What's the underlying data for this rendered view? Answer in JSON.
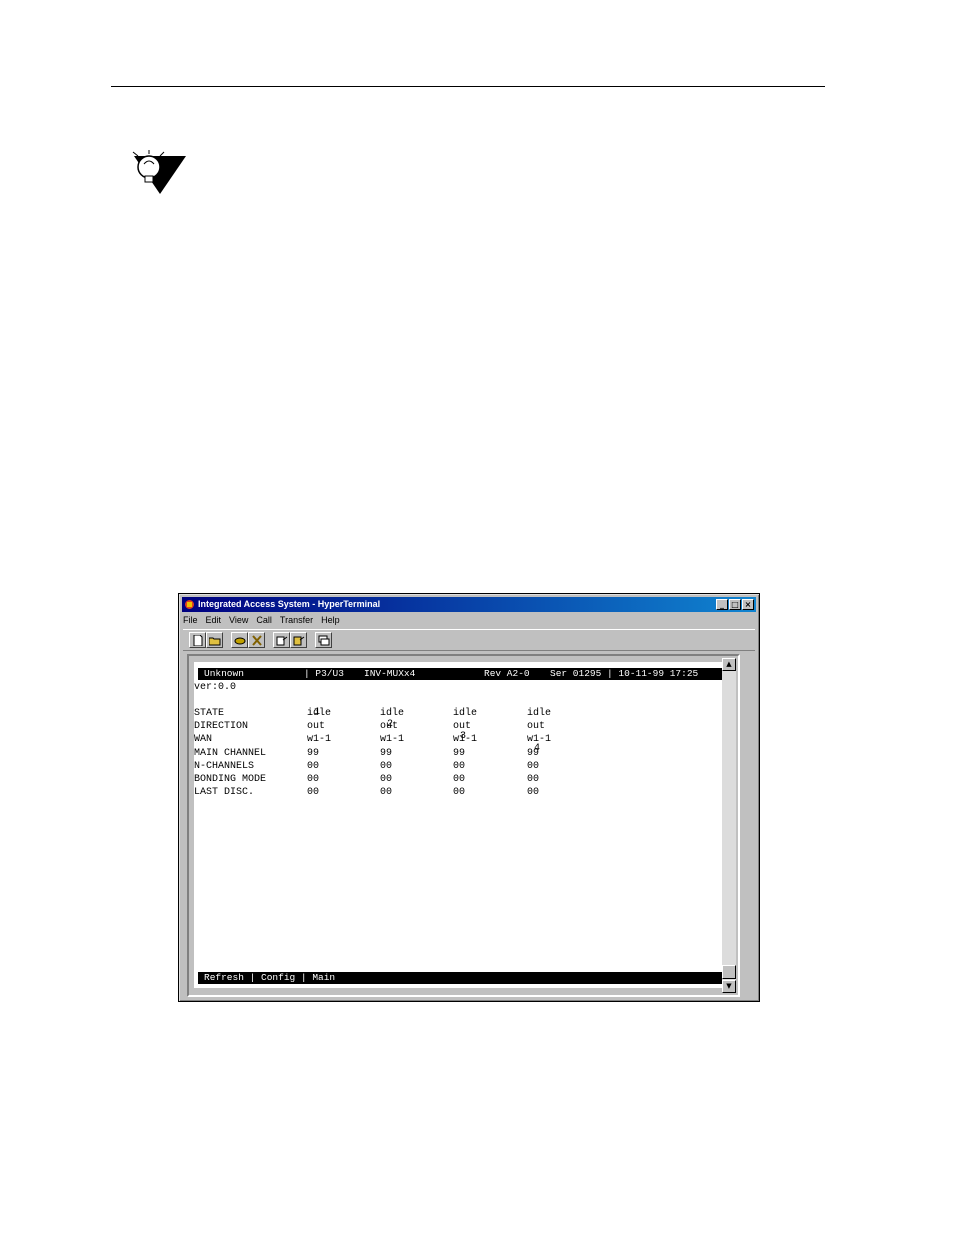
{
  "window": {
    "title": "Integrated Access System - HyperTerminal",
    "buttons": {
      "minimize": "_",
      "maximize": "□",
      "close": "×"
    }
  },
  "menu": [
    "File",
    "Edit",
    "View",
    "Call",
    "Transfer",
    "Help"
  ],
  "terminal": {
    "header": {
      "name": "Unknown",
      "slot": "| P3/U3",
      "card": "INV-MUXx4",
      "rev": "Rev A2-0",
      "ser": "Ser 01295 | 10-11-99 17:25"
    },
    "version": "ver:0.0",
    "columns": [
      "1",
      "2",
      "3",
      "4"
    ],
    "rows": [
      {
        "label": "STATE",
        "values": [
          "idle",
          "idle",
          "idle",
          "idle"
        ]
      },
      {
        "label": "DIRECTION",
        "values": [
          "out",
          "out",
          "out",
          "out"
        ]
      },
      {
        "label": "WAN",
        "values": [
          "w1-1",
          "w1-1",
          "w1-1",
          "w1-1"
        ]
      },
      {
        "label": "MAIN CHANNEL",
        "values": [
          "99",
          "99",
          "99",
          "99"
        ]
      },
      {
        "label": "N-CHANNELS",
        "values": [
          "00",
          "00",
          "00",
          "00"
        ]
      },
      {
        "label": "BONDING MODE",
        "values": [
          "00",
          "00",
          "00",
          "00"
        ]
      },
      {
        "label": "LAST DISC.",
        "values": [
          "00",
          "00",
          "00",
          "00"
        ]
      }
    ],
    "footer": "Refresh | Config | Main"
  },
  "icons": {
    "note": "lightbulb-note-icon",
    "toolbar": [
      "new-icon",
      "open-icon",
      "connect-icon",
      "disconnect-icon",
      "send-icon",
      "receive-icon",
      "properties-icon"
    ]
  }
}
